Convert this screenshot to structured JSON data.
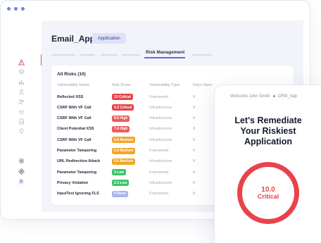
{
  "app": {
    "name": "Email_App",
    "type_pill": "Application"
  },
  "tabs": {
    "active_label": "Risk Management"
  },
  "risks": {
    "title": "All Risks (10)",
    "columns": [
      "Vulnerability Name",
      "Risk Score",
      "Vulnerability Type",
      "Days Open"
    ],
    "rows": [
      {
        "name": "Reflected XSS",
        "score": "10 Critical",
        "color": "#e8434a",
        "type": "Framework",
        "days": "8"
      },
      {
        "name": "CSRF With VF Call",
        "score": "9.3 Critical",
        "color": "#e8434a",
        "type": "Infrastructure",
        "days": "8"
      },
      {
        "name": "CSRF With VF Call",
        "score": "8.5 High",
        "color": "#ef5b5f",
        "type": "Infrastructure",
        "days": "8"
      },
      {
        "name": "Client Potential XSS",
        "score": "7.4 High",
        "color": "#ef5b5f",
        "type": "Infrastructure",
        "days": "8"
      },
      {
        "name": "CSRF With VF Call",
        "score": "6.8 Medium",
        "color": "#f5a524",
        "type": "Infrastructure",
        "days": "8"
      },
      {
        "name": "Parameter Tampering",
        "score": "6.3 Medium",
        "color": "#f5a524",
        "type": "Framework",
        "days": "8"
      },
      {
        "name": "URL Redirection Attack",
        "score": "5.6 Medium",
        "color": "#f5a524",
        "type": "Infrastructure",
        "days": "8"
      },
      {
        "name": "Parameter Tampering",
        "score": "3 Low",
        "color": "#3bc46a",
        "type": "Framework",
        "days": "8"
      },
      {
        "name": "Privacy Violation",
        "score": "2.3 Low",
        "color": "#3bc46a",
        "type": "Infrastructure",
        "days": "8"
      },
      {
        "name": "InputText Ignoring FLS",
        "score": "0 None",
        "color": "#a9b4f2",
        "type": "Framework",
        "days": "8"
      }
    ]
  },
  "phone": {
    "welcome": "Welcome John Smith",
    "org": "CRM_App",
    "headline": [
      "Let's Remediate",
      "Your Riskiest",
      "Application"
    ],
    "score_value": "10.0",
    "score_label": "Critical"
  },
  "colors": {
    "accent": "#5b6fd6",
    "critical": "#e8434a"
  },
  "icons": {
    "sidebar": [
      "warning-icon",
      "layers-icon",
      "chart-icon",
      "people-icon",
      "users-icon",
      "bug-icon",
      "document-icon",
      "lightbulb-icon"
    ],
    "bottom": [
      "gear-icon",
      "target-icon"
    ]
  }
}
